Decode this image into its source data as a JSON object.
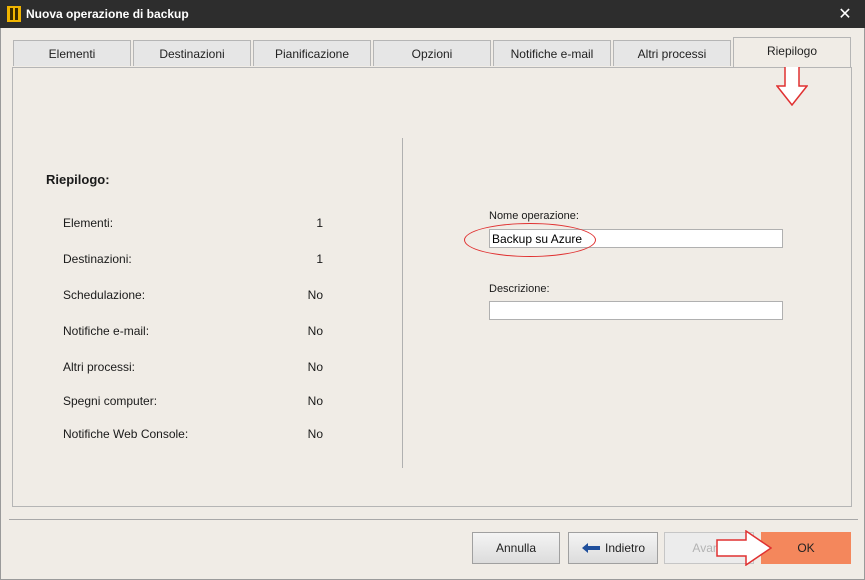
{
  "window": {
    "title": "Nuova operazione di backup",
    "close_glyph": "✕"
  },
  "tabs": [
    {
      "label": "Elementi"
    },
    {
      "label": "Destinazioni"
    },
    {
      "label": "Pianificazione"
    },
    {
      "label": "Opzioni"
    },
    {
      "label": "Notifiche e-mail"
    },
    {
      "label": "Altri processi"
    },
    {
      "label": "Riepilogo",
      "active": true
    }
  ],
  "summary": {
    "title": "Riepilogo:",
    "rows": [
      {
        "label": "Elementi:",
        "value": "1"
      },
      {
        "label": "Destinazioni:",
        "value": "1"
      },
      {
        "label": "Schedulazione:",
        "value": "No"
      },
      {
        "label": "Notifiche e-mail:",
        "value": "No"
      },
      {
        "label": "Altri processi:",
        "value": "No"
      },
      {
        "label": "Spegni computer:",
        "value": "No"
      },
      {
        "label": "Notifiche Web Console:",
        "value": "No"
      }
    ]
  },
  "form": {
    "name_label": "Nome operazione:",
    "name_value": "Backup su Azure",
    "description_label": "Descrizione:",
    "description_value": ""
  },
  "buttons": {
    "cancel": "Annulla",
    "back": "Indietro",
    "next": "Avanti",
    "ok": "OK"
  },
  "colors": {
    "ok_button": "#f4875c",
    "annotation": "#e03131",
    "titlebar": "#2d2d2d"
  }
}
